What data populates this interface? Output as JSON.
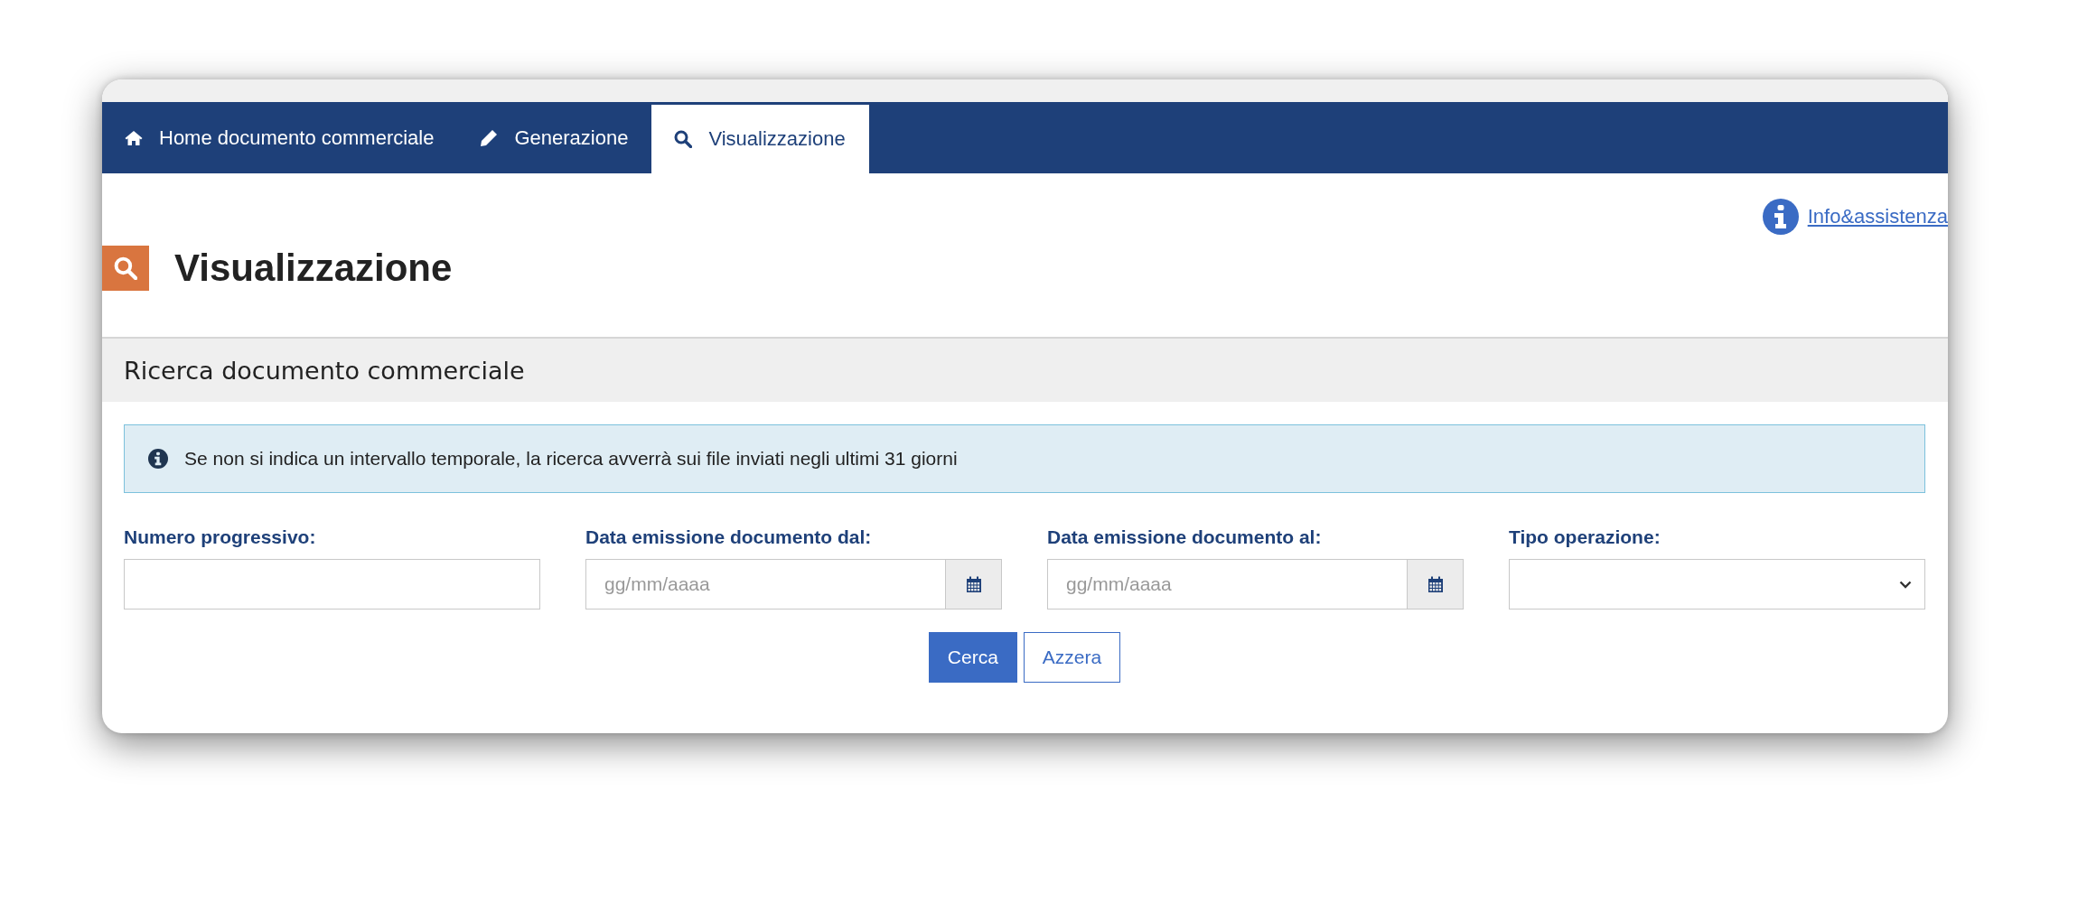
{
  "nav": {
    "tabs": [
      {
        "label": "Home documento commerciale",
        "kind": "home",
        "selected": false
      },
      {
        "label": "Generazione",
        "kind": "edit",
        "selected": false
      },
      {
        "label": "Visualizzazione",
        "kind": "search",
        "selected": true
      }
    ]
  },
  "info_link": "Info&assistenza",
  "page_title": "Visualizzazione",
  "section": {
    "title": "Ricerca documento commerciale",
    "alert": "Se non si indica un intervallo temporale, la ricerca avverrà sui file inviati negli ultimi 31 giorni",
    "fields": [
      {
        "kind": "text",
        "label": "Numero progressivo:"
      },
      {
        "kind": "date",
        "label": "Data emissione documento dal:",
        "placeholder": "gg/mm/aaaa"
      },
      {
        "kind": "date",
        "label": "Data emissione documento al:",
        "placeholder": "gg/mm/aaaa"
      },
      {
        "kind": "select",
        "label": "Tipo operazione:"
      }
    ],
    "buttons": [
      {
        "label": "Cerca",
        "kind": "primary"
      },
      {
        "label": "Azzera",
        "kind": "secondary"
      }
    ]
  }
}
